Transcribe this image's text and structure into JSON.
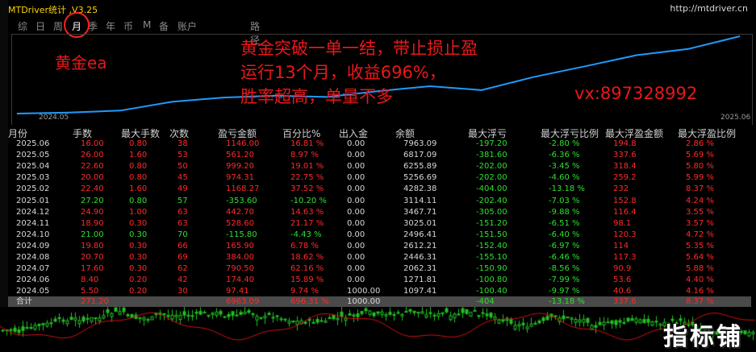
{
  "window": {
    "title": "MTDriver统计 ,V3.25",
    "url": "http://mtdriver.cn"
  },
  "tabs": [
    "综",
    "日",
    "周",
    "月",
    "季",
    "年",
    "币",
    "M",
    "备",
    "账户",
    "路径"
  ],
  "active_tab": "月",
  "overlay": {
    "label": "黄金ea",
    "line1": "黄金突破一单一结，带止损止盈",
    "line2": "运行13个月，收益696%，",
    "line3": "胜率超高，单量不多",
    "contact": "vx:897328992"
  },
  "chart_data": {
    "type": "line",
    "x": [
      "2024.05",
      "2024.06",
      "2024.07",
      "2024.08",
      "2024.09",
      "2024.10",
      "2024.11",
      "2024.12",
      "2025.01",
      "2025.02",
      "2025.03",
      "2025.04",
      "2025.05",
      "2025.06"
    ],
    "values": [
      1000.0,
      1097.41,
      1271.81,
      2062.31,
      2446.31,
      2612.21,
      2496.41,
      3025.01,
      3467.71,
      3114.11,
      4282.38,
      5256.69,
      6255.89,
      6817.09,
      7963.09
    ],
    "x_start_label": "2024.05",
    "x_end_label": "2025.06",
    "color": "#1e9bff"
  },
  "table": {
    "columns": [
      "月份",
      "手数",
      "最大手数",
      "次数",
      "盈亏金额",
      "百分比%",
      "出入金",
      "余额",
      "最大浮亏",
      "最大浮亏比例",
      "最大浮盈金额",
      "最大浮盈比例"
    ],
    "rows": [
      [
        "2025.06",
        "16.00",
        "0.80",
        "38",
        "1146.00",
        "16.81 %",
        "0.00",
        "7963.09",
        "-197.20",
        "-2.80 %",
        "194.8",
        "2.86 %"
      ],
      [
        "2025.05",
        "26.00",
        "1.60",
        "53",
        "561.20",
        "8.97 %",
        "0.00",
        "6817.09",
        "-381.60",
        "-6.36 %",
        "337.6",
        "5.69 %"
      ],
      [
        "2025.04",
        "22.60",
        "0.80",
        "50",
        "999.20",
        "19.01 %",
        "0.00",
        "6255.89",
        "-202.00",
        "-3.45 %",
        "318.4",
        "5.80 %"
      ],
      [
        "2025.03",
        "20.00",
        "0.80",
        "45",
        "974.31",
        "22.75 %",
        "0.00",
        "5256.69",
        "-202.00",
        "-4.60 %",
        "259.2",
        "5.99 %"
      ],
      [
        "2025.02",
        "22.40",
        "1.60",
        "49",
        "1168.27",
        "37.52 %",
        "0.00",
        "4282.38",
        "-404.00",
        "-13.18 %",
        "232",
        "8.37 %"
      ],
      [
        "2025.01",
        "27.20",
        "0.80",
        "57",
        "-353.60",
        "-10.20 %",
        "0.00",
        "3114.11",
        "-202.40",
        "-7.03 %",
        "152.8",
        "4.24 %"
      ],
      [
        "2024.12",
        "24.90",
        "1.00",
        "63",
        "442.70",
        "14.63 %",
        "0.00",
        "3467.71",
        "-305.00",
        "-9.88 %",
        "116.4",
        "3.55 %"
      ],
      [
        "2024.11",
        "18.90",
        "0.30",
        "63",
        "528.60",
        "21.17 %",
        "0.00",
        "3025.01",
        "-151.20",
        "-6.51 %",
        "98.1",
        "3.57 %"
      ],
      [
        "2024.10",
        "21.00",
        "0.30",
        "70",
        "-115.80",
        "-4.43 %",
        "0.00",
        "2496.41",
        "-151.50",
        "-6.40 %",
        "120.3",
        "4.72 %"
      ],
      [
        "2024.09",
        "19.80",
        "0.30",
        "66",
        "165.90",
        "6.78 %",
        "0.00",
        "2612.21",
        "-152.40",
        "-6.97 %",
        "114",
        "5.35 %"
      ],
      [
        "2024.08",
        "20.70",
        "0.30",
        "69",
        "384.00",
        "18.62 %",
        "0.00",
        "2446.31",
        "-155.10",
        "-6.46 %",
        "117.3",
        "5.64 %"
      ],
      [
        "2024.07",
        "17.60",
        "0.30",
        "62",
        "790.50",
        "62.16 %",
        "0.00",
        "2062.31",
        "-150.90",
        "-8.56 %",
        "90.9",
        "5.88 %"
      ],
      [
        "2024.06",
        "8.40",
        "0.20",
        "42",
        "174.40",
        "15.89 %",
        "0.00",
        "1271.81",
        "-100.80",
        "-7.99 %",
        "53.6",
        "4.40 %"
      ],
      [
        "2024.05",
        "5.50",
        "0.20",
        "30",
        "97.41",
        "9.74 %",
        "1000.00",
        "1097.41",
        "-100.40",
        "-9.97 %",
        "40.6",
        "4.16 %"
      ]
    ],
    "total": [
      "合计",
      "271.20",
      "",
      "",
      "6963.09",
      "696.31 %",
      "1000.00",
      "",
      "-404",
      "-13.18 %",
      "337.6",
      "8.37 %"
    ]
  },
  "colors": {
    "profit": "#ff2a2a",
    "loss": "#2ee02e",
    "neutral": "#d8d8d8",
    "title": "#ffd400",
    "accent": "#1e9bff"
  },
  "watermark": "指标铺"
}
